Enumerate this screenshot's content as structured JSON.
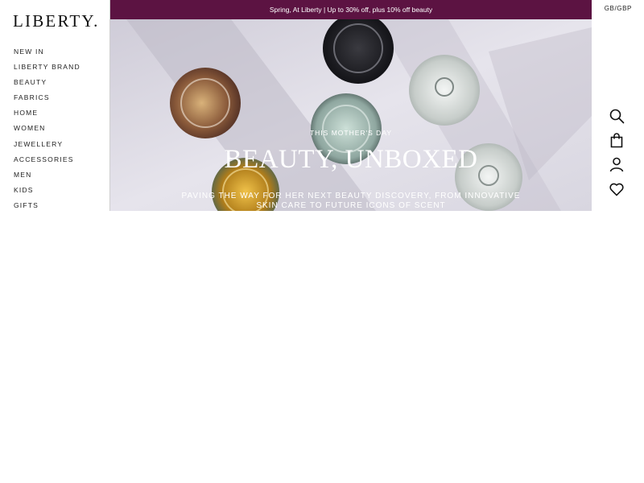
{
  "brand": {
    "logo_text": "LIBERTY."
  },
  "nav": {
    "items": [
      {
        "label": "NEW IN"
      },
      {
        "label": "LIBERTY BRAND"
      },
      {
        "label": "BEAUTY"
      },
      {
        "label": "FABRICS"
      },
      {
        "label": "HOME"
      },
      {
        "label": "WOMEN"
      },
      {
        "label": "JEWELLERY"
      },
      {
        "label": "ACCESSORIES"
      },
      {
        "label": "MEN"
      },
      {
        "label": "KIDS"
      },
      {
        "label": "GIFTS"
      }
    ]
  },
  "promo": {
    "text": "Spring, At Liberty | Up to 30% off, plus 10% off beauty",
    "background": "#5c1342"
  },
  "locale": {
    "label": "GB/GBP"
  },
  "hero": {
    "eyebrow": "THIS MOTHER'S DAY",
    "headline": "BEAUTY, UNBOXED",
    "subcopy": "PAVING THE WAY FOR HER NEXT BEAUTY DISCOVERY, FROM INNOVATIVE SKIN CARE TO FUTURE ICONS OF SCENT"
  },
  "icons": [
    "search-icon",
    "bag-icon",
    "account-icon",
    "wishlist-heart-icon"
  ]
}
